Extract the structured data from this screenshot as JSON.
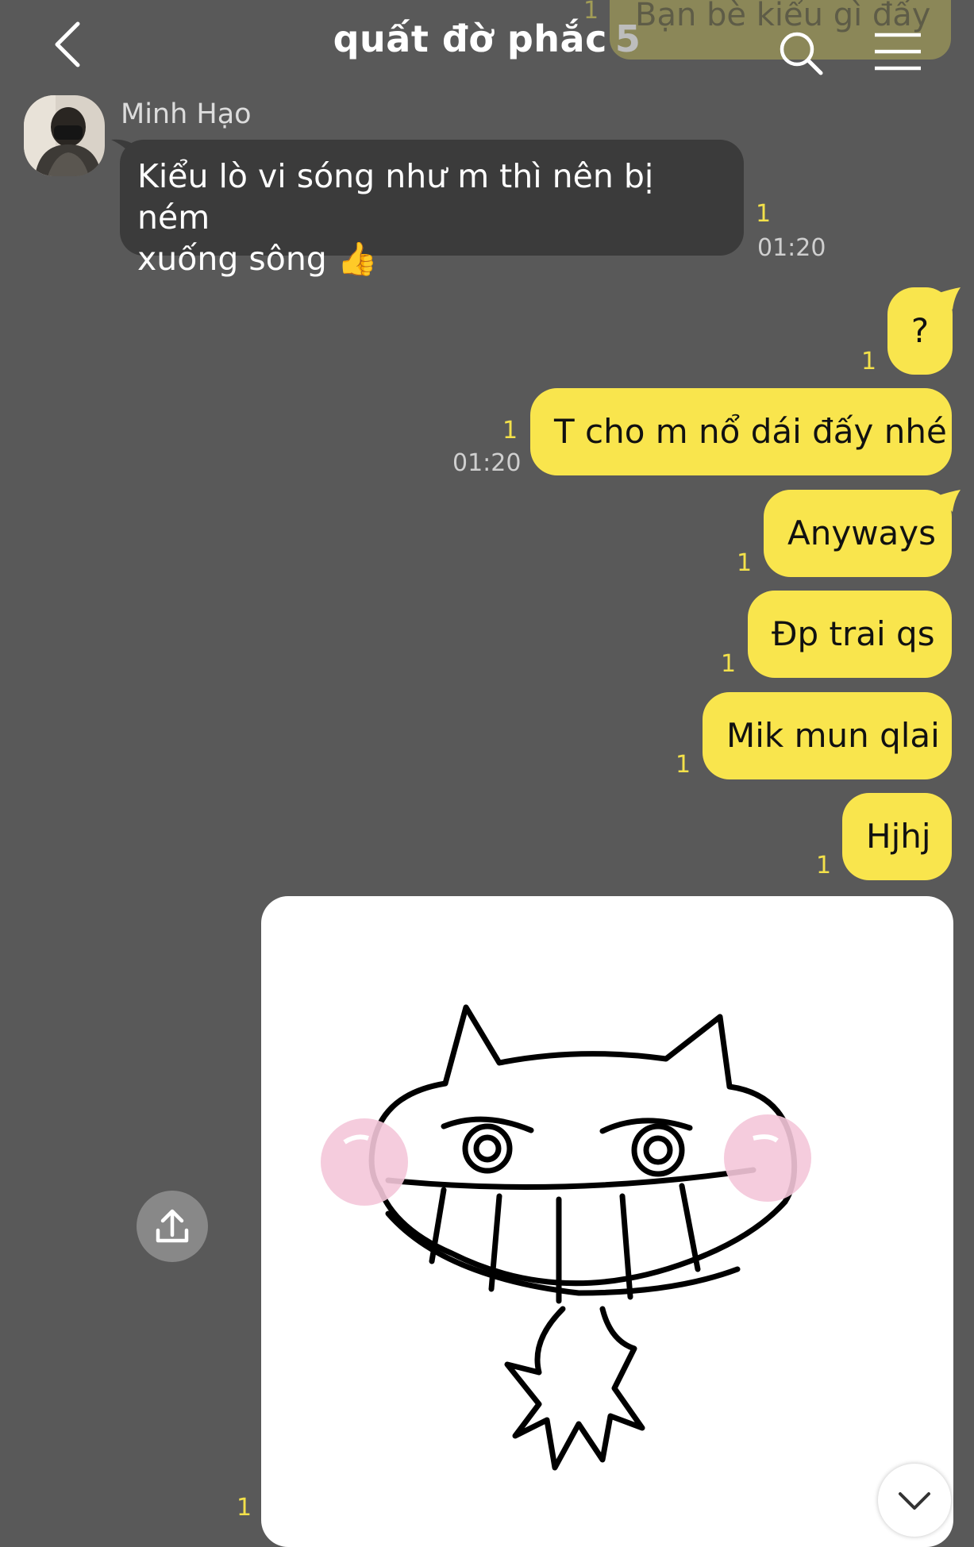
{
  "header": {
    "title": "quất đờ phắc",
    "member_count": "5",
    "ghost_message": "Bạn bè kiểu gì đấy",
    "ghost_unread": "1"
  },
  "icons": {
    "back": "chevron-left-icon",
    "search": "search-icon",
    "menu": "hamburger-menu-icon",
    "share": "share-upload-icon",
    "scroll_down": "chevron-down-icon",
    "thumbs_up": "thumbs-up-emoji"
  },
  "colors": {
    "background": "#595959",
    "sent_bubble": "#f9e54d",
    "received_bubble": "#3b3b3b",
    "unread_count": "#f3e14a"
  },
  "received": {
    "sender": "Minh Hạo",
    "line1": "Kiểu lò vi sóng như m thì nên bị ném",
    "line2": "xuống sông",
    "emoji": "👍",
    "unread": "1",
    "time": "01:20"
  },
  "sent_messages": [
    {
      "text": "?",
      "unread": "1",
      "time": ""
    },
    {
      "text": "T cho m nổ dái đấy nhé",
      "unread": "1",
      "time": "01:20"
    },
    {
      "text": "Anyways",
      "unread": "1",
      "time": ""
    },
    {
      "text": "Đp trai qs",
      "unread": "1",
      "time": ""
    },
    {
      "text": "Mik mun qlai",
      "unread": "1",
      "time": ""
    },
    {
      "text": "Hjhj",
      "unread": "1",
      "time": ""
    }
  ],
  "sticker": {
    "description_icon": "grinning-cat-sticker",
    "unread": "1"
  }
}
